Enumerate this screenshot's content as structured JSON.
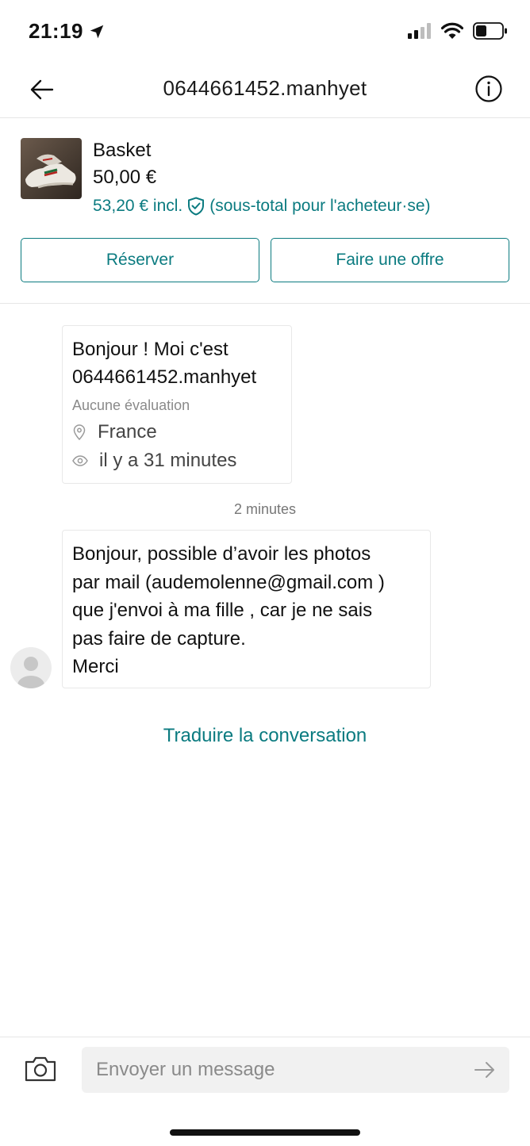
{
  "status_bar": {
    "time": "21:19"
  },
  "header": {
    "title": "0644661452.manhyet"
  },
  "item": {
    "title": "Basket",
    "price": "50,00 €",
    "total_price": "53,20 € incl.",
    "total_note": "(sous-total pour l'acheteur·se)"
  },
  "actions": {
    "reserve_label": "Réserver",
    "offer_label": "Faire une offre"
  },
  "intro": {
    "line1": "Bonjour ! Moi c'est",
    "line2": "0644661452.manhyet",
    "rating": "Aucune évaluation",
    "location": "France",
    "last_seen": "il y a 31 minutes"
  },
  "conversation": {
    "timestamp": "2 minutes",
    "message": "Bonjour, possible d’avoir les photos\npar mail (audemolenne@gmail.com )\nque j'envoi à ma fille , car je ne sais\npas faire de capture.\nMerci"
  },
  "translate_label": "Traduire la conversation",
  "composer": {
    "placeholder": "Envoyer un message"
  },
  "colors": {
    "accent": "#0b7b80",
    "divider": "#e6e6e6",
    "input_bg": "#f1f1f1"
  },
  "icons": [
    "location-arrow-icon",
    "signal-icon",
    "wifi-icon",
    "battery-icon",
    "back-arrow-icon",
    "info-icon",
    "shield-check-icon",
    "pin-icon",
    "eye-icon",
    "avatar-icon",
    "camera-icon",
    "send-arrow-icon"
  ]
}
